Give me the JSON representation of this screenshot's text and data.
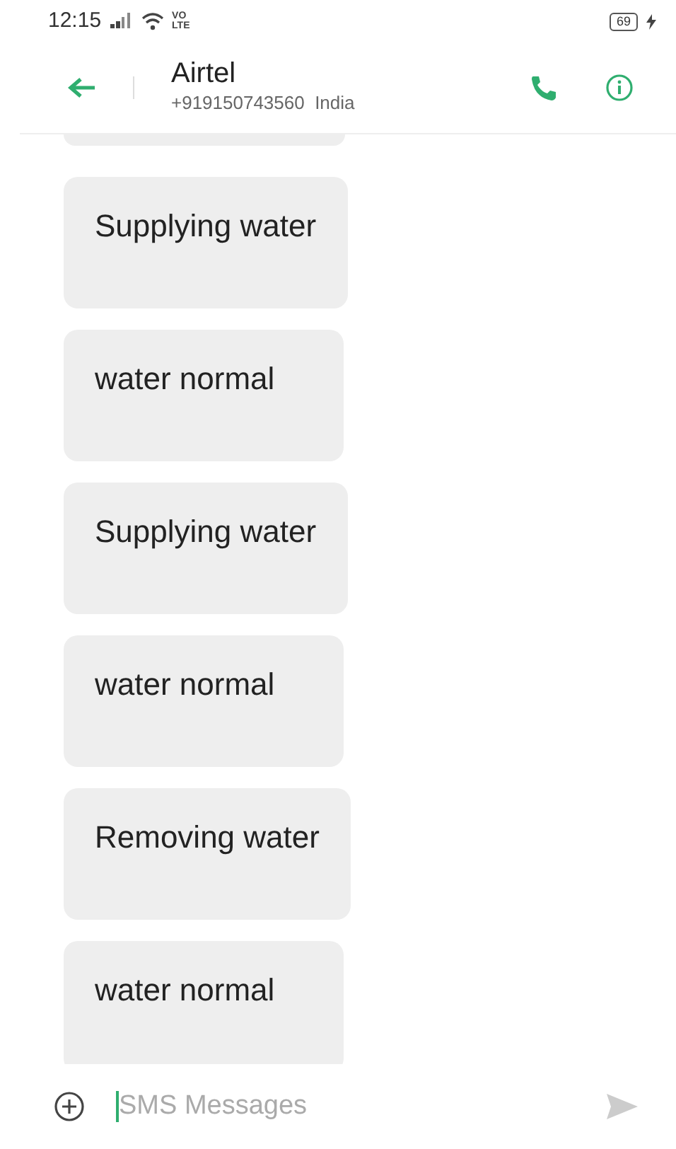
{
  "status_bar": {
    "time": "12:15",
    "network_badge": [
      "VO",
      "LTE"
    ],
    "battery": "69"
  },
  "header": {
    "name": "Airtel",
    "number": "+919150743560",
    "country": "India"
  },
  "messages": [
    {
      "text": "Supplying water"
    },
    {
      "text": "water normal"
    },
    {
      "text": "Supplying water"
    },
    {
      "text": "water normal"
    },
    {
      "text": "Removing water"
    },
    {
      "text": "water normal"
    }
  ],
  "composer": {
    "placeholder": "SMS Messages"
  }
}
